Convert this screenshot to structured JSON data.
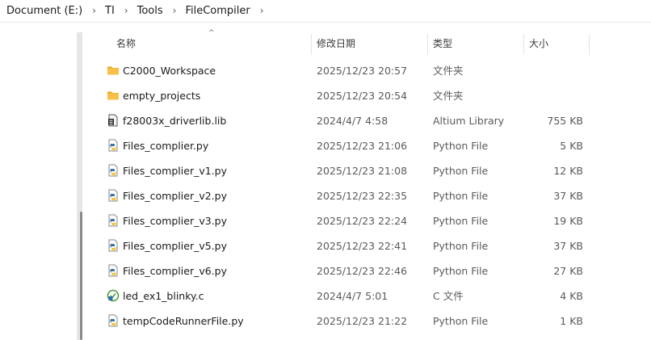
{
  "breadcrumb": [
    "Document (E:)",
    "TI",
    "Tools",
    "FileCompiler"
  ],
  "breadcrumb_separator": "›",
  "columns": {
    "name": "名称",
    "date": "修改日期",
    "type": "类型",
    "size": "大小"
  },
  "sort_indicator": "^",
  "files": [
    {
      "name": "C2000_Workspace",
      "date": "2025/12/23 20:57",
      "type": "文件夹",
      "size": "",
      "icon": "folder-icon"
    },
    {
      "name": "empty_projects",
      "date": "2025/12/23 20:54",
      "type": "文件夹",
      "size": "",
      "icon": "folder-icon"
    },
    {
      "name": "f28003x_driverlib.lib",
      "date": "2024/4/7 4:58",
      "type": "Altium Library",
      "size": "755 KB",
      "icon": "library-file-icon"
    },
    {
      "name": "Files_complier.py",
      "date": "2025/12/23 21:06",
      "type": "Python File",
      "size": "5 KB",
      "icon": "python-file-icon"
    },
    {
      "name": "Files_complier_v1.py",
      "date": "2025/12/23 21:08",
      "type": "Python File",
      "size": "12 KB",
      "icon": "python-file-icon"
    },
    {
      "name": "Files_complier_v2.py",
      "date": "2025/12/23 22:35",
      "type": "Python File",
      "size": "37 KB",
      "icon": "python-file-icon"
    },
    {
      "name": "Files_complier_v3.py",
      "date": "2025/12/23 22:24",
      "type": "Python File",
      "size": "19 KB",
      "icon": "python-file-icon"
    },
    {
      "name": "Files_complier_v5.py",
      "date": "2025/12/23 22:41",
      "type": "Python File",
      "size": "37 KB",
      "icon": "python-file-icon"
    },
    {
      "name": "Files_complier_v6.py",
      "date": "2025/12/23 22:46",
      "type": "Python File",
      "size": "27 KB",
      "icon": "python-file-icon"
    },
    {
      "name": "led_ex1_blinky.c",
      "date": "2024/4/7 5:01",
      "type": "C 文件",
      "size": "4 KB",
      "icon": "c-file-icon"
    },
    {
      "name": "tempCodeRunnerFile.py",
      "date": "2025/12/23 21:22",
      "type": "Python File",
      "size": "1 KB",
      "icon": "python-file-icon"
    }
  ],
  "colors": {
    "folder": "#f7c04a",
    "folder_tab": "#e8a824",
    "python_blue": "#3572a5",
    "python_yellow": "#f2c744",
    "c_green": "#4a9d3c",
    "text": "#1a1a1a",
    "secondary_text": "#5a5a5a"
  }
}
